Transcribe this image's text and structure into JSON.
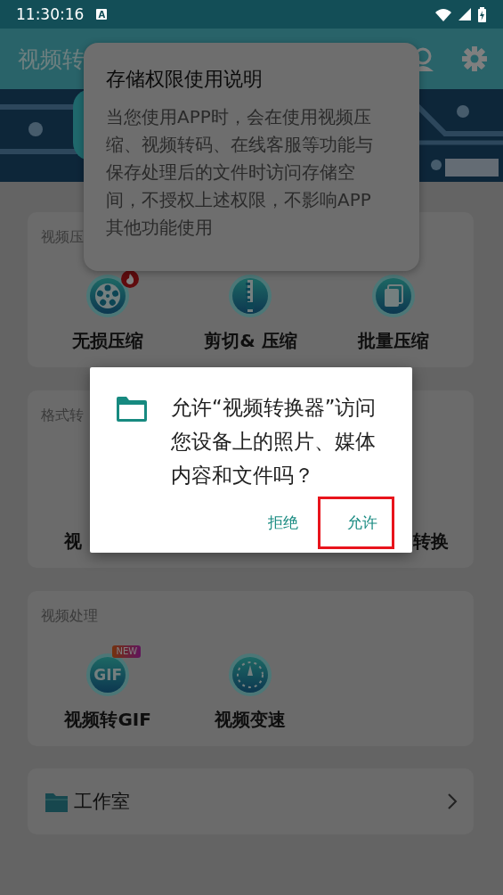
{
  "status_bar": {
    "time": "11:30:16",
    "indicator": "A"
  },
  "app_bar": {
    "title": "视频转"
  },
  "sections": [
    {
      "title": "视频压",
      "kind": "full",
      "items": [
        {
          "label": "无损压缩",
          "kind": "reel",
          "badge": {
            "kind": "hot"
          }
        },
        {
          "label": "剪切& 压缩",
          "kind": "zip"
        },
        {
          "label": "批量压缩",
          "kind": "stack"
        }
      ]
    },
    {
      "title": "格式转",
      "kind": "partial",
      "items": [
        {
          "label": "视"
        },
        {
          "label": "转换"
        }
      ]
    },
    {
      "title": "视频处理",
      "kind": "full",
      "items": [
        {
          "label": "视频转GIF",
          "kind": "gif",
          "icon_text": "GIF",
          "badge": {
            "kind": "new",
            "text": "NEW"
          }
        },
        {
          "label": "视频变速",
          "kind": "speed"
        }
      ]
    }
  ],
  "studio": {
    "label": "工作室"
  },
  "info_popup": {
    "title": "存储权限使用说明",
    "body": "当您使用APP时，会在使用视频压缩、视频转码、在线客服等功能与保存处理后的文件时访问存储空间，不授权上述权限，不影响APP其他功能使用"
  },
  "dialog": {
    "message": "允许“视频转换器”访问您设备上的照片、媒体内容和文件吗？",
    "buttons": [
      {
        "label": "拒绝",
        "highlighted": false
      },
      {
        "label": "允许",
        "highlighted": true
      }
    ]
  }
}
